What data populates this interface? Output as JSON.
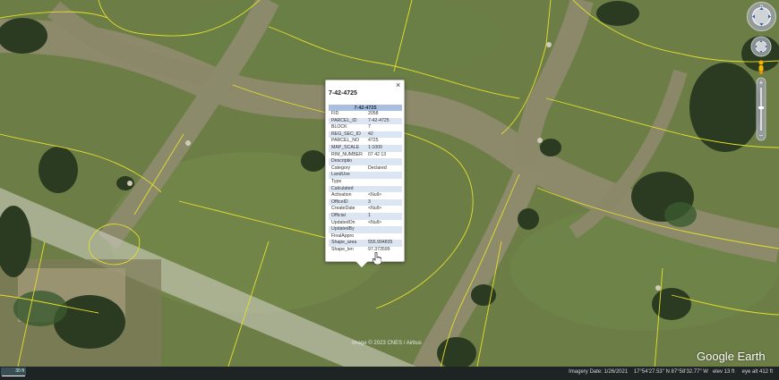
{
  "popup": {
    "title": "7-42-4725",
    "close_symbol": "×",
    "table_header": "7-42-4725",
    "rows": [
      {
        "key": "FID",
        "value": "2058"
      },
      {
        "key": "PARCEL_ID",
        "value": "7-42-4725"
      },
      {
        "key": "BLOCK",
        "value": "7"
      },
      {
        "key": "REG_SEC_ID",
        "value": "42"
      },
      {
        "key": "PARCEL_NO",
        "value": "4725"
      },
      {
        "key": "MAP_SCALE",
        "value": "1:1000"
      },
      {
        "key": "RIM_NUMBER",
        "value": "07 42 13"
      },
      {
        "key": "Descriptio",
        "value": ""
      },
      {
        "key": "Category",
        "value": "Declared"
      },
      {
        "key": "LandUse",
        "value": ""
      },
      {
        "key": "Type",
        "value": ""
      },
      {
        "key": "Calculated",
        "value": ""
      },
      {
        "key": "Activation",
        "value": "<Null>"
      },
      {
        "key": "OfficeID",
        "value": "3"
      },
      {
        "key": "CreateDate",
        "value": "<Null>"
      },
      {
        "key": "Official",
        "value": "1"
      },
      {
        "key": "UpdatedOn",
        "value": "<Null>"
      },
      {
        "key": "UpdatedBy",
        "value": ""
      },
      {
        "key": "FinalAppro",
        "value": ""
      },
      {
        "key": "Shape_area",
        "value": "555.994835"
      },
      {
        "key": "Shape_len",
        "value": "97.373599"
      }
    ]
  },
  "map": {
    "copyright": "Image © 2023 CNES / Airbus",
    "logo": "Google Earth"
  },
  "statusbar": {
    "scale_label": "30 ft",
    "imagery_date": "Imagery Date: 1/26/2021",
    "coordinates": "17°54'27.53\" N   87°58'32.77\" W",
    "elevation": "elev   13 ft",
    "eye_alt": "eye alt   412 ft"
  },
  "colors": {
    "parcel_line": "#e4df2b",
    "header_blue": "#a8bfe0",
    "row_alt": "#dce6f2",
    "statusbar": "#1e2324"
  }
}
